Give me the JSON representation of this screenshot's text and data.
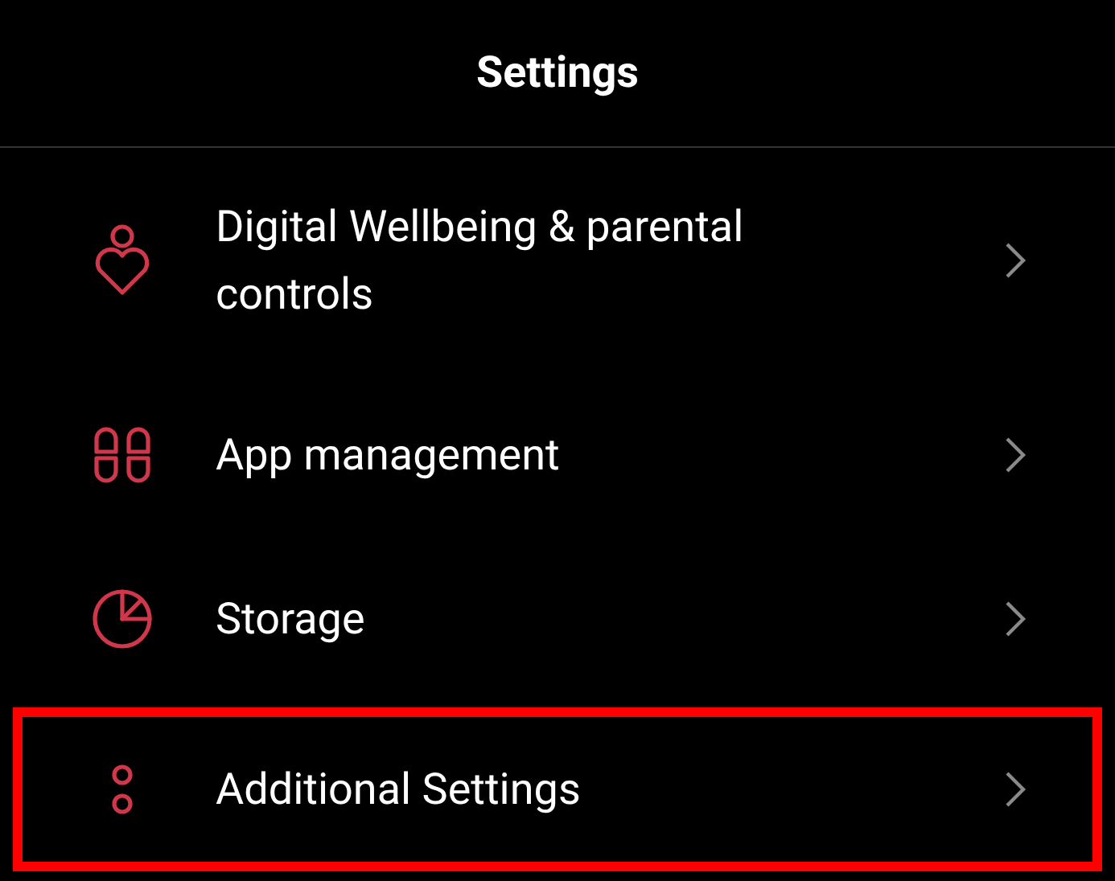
{
  "header": {
    "title": "Settings"
  },
  "items": [
    {
      "label": "Digital Wellbeing & parental controls",
      "highlighted": false
    },
    {
      "label": "App management",
      "highlighted": false
    },
    {
      "label": "Storage",
      "highlighted": false
    },
    {
      "label": "Additional Settings",
      "highlighted": true
    }
  ]
}
